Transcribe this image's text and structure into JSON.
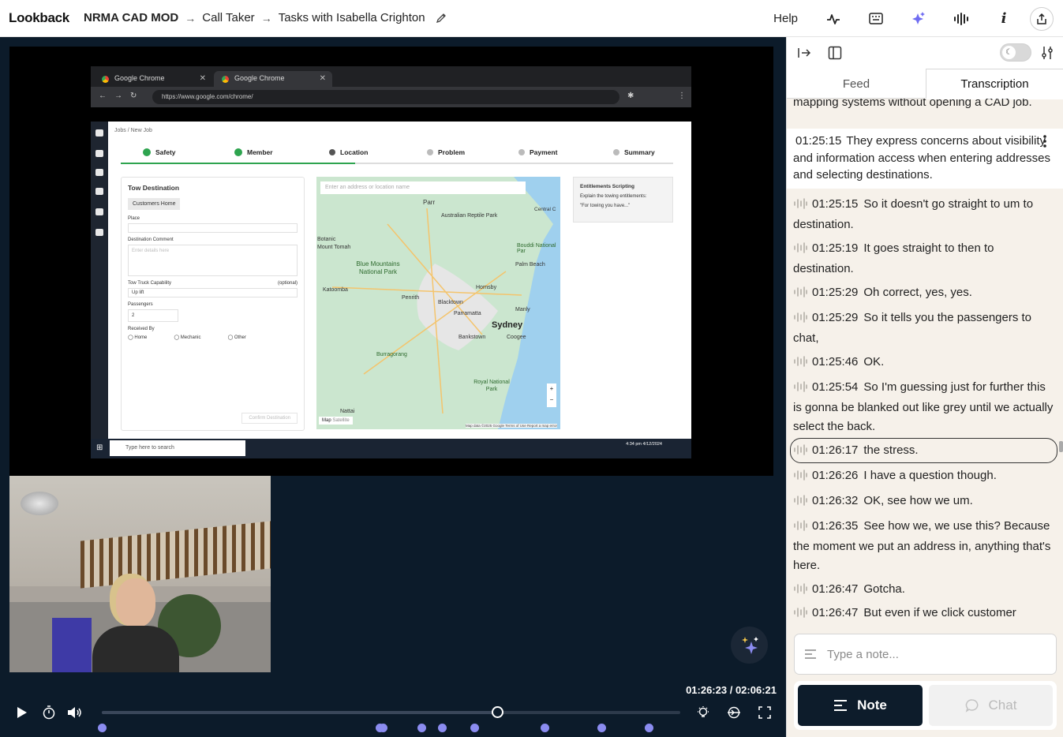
{
  "app": {
    "logo": "Lookback"
  },
  "breadcrumb": {
    "project": "NRMA CAD MOD",
    "section": "Call Taker",
    "session": "Tasks with Isabella Crighton",
    "separator": "→"
  },
  "topbar": {
    "help": "Help",
    "icons": [
      "activity-icon",
      "keyboard-icon",
      "sparkles-icon",
      "waveform-icon",
      "info-icon",
      "share-icon"
    ]
  },
  "capture": {
    "tab1": "Google Chrome",
    "tab2": "Google Chrome",
    "url": "https://www.google.com/chrome/",
    "crumb": "Jobs / New Job",
    "steps": [
      "Safety",
      "Member",
      "Location",
      "Problem",
      "Payment",
      "Summary"
    ],
    "form_title": "Tow Destination",
    "chip": "Customers Home",
    "place_label": "Place",
    "comment_label": "Destination Comment",
    "comment_placeholder": "Enter details here",
    "capability_label": "Tow Truck Capability",
    "capability_value": "Up lift",
    "optional": "(optional)",
    "passengers_label": "Passengers",
    "passengers_value": "2",
    "received_label": "Received By",
    "received_options": [
      "Home",
      "Mechanic",
      "Other"
    ],
    "confirm": "Confirm Destination",
    "map_search_placeholder": "Enter an address or location name",
    "map_places": [
      "Parr",
      "Australian Reptile Park",
      "Central C",
      "Bouddi National Par",
      "Palm Beach",
      "Blue Mountains National Park",
      "Katoomba",
      "Penrith",
      "Blacktown",
      "Hornsby",
      "Manly",
      "Parramatta",
      "Sydney",
      "Bankstown",
      "Coogee",
      "Burragorang",
      "Royal National Park",
      "Nattai",
      "Botanic",
      "Mount Tomah"
    ],
    "map_modes": [
      "Map",
      "Satellite"
    ],
    "map_footer": "Map data ©2025 Google   Terms of Use   Report a map error",
    "ent_title": "Entitlements Scripting",
    "ent_text": "Explain the towing entitlements:",
    "ent_quote": "\"For towing you have...\"",
    "taskbar_search": "Type here to search",
    "clock": "4:34 pm 4/12/2024"
  },
  "player": {
    "current": "01:26:23",
    "total": "02:06:21",
    "progress_fraction": 0.683,
    "markers": [
      0.0,
      0.48,
      0.485,
      0.553,
      0.588,
      0.644,
      0.765,
      0.863,
      0.946
    ]
  },
  "panel": {
    "tabs": [
      "Feed",
      "Transcription"
    ],
    "active_tab": "Transcription",
    "summary_cut": "mapping systems without opening a CAD job.",
    "summary": {
      "time": "01:25:15",
      "text": "They express concerns about visibility and information access when entering addresses and selecting destinations."
    },
    "lines": [
      {
        "time": "01:25:15",
        "text": "So it doesn't go straight to um to destination."
      },
      {
        "time": "01:25:19",
        "text": "It goes straight to then to destination."
      },
      {
        "time": "01:25:29",
        "text": "Oh correct, yes, yes."
      },
      {
        "time": "01:25:29",
        "text": "So it tells you the passengers to chat,"
      },
      {
        "time": "01:25:46",
        "text": "OK."
      },
      {
        "time": "01:25:54",
        "text": "So I'm guessing just for further this is gonna be blanked out like grey until we actually select the back."
      },
      {
        "time": "01:26:17",
        "text": "the stress."
      },
      {
        "time": "01:26:26",
        "text": "I have a question though."
      },
      {
        "time": "01:26:32",
        "text": "OK, see how we um."
      },
      {
        "time": "01:26:35",
        "text": "See how we, we use this? Because the moment we put an address in, anything that's here."
      },
      {
        "time": "01:26:47",
        "text": "Gotcha."
      },
      {
        "time": "01:26:47",
        "text": "But even if we click customer"
      }
    ],
    "note_placeholder": "Type a note...",
    "note_button": "Note",
    "chat_button": "Chat"
  }
}
